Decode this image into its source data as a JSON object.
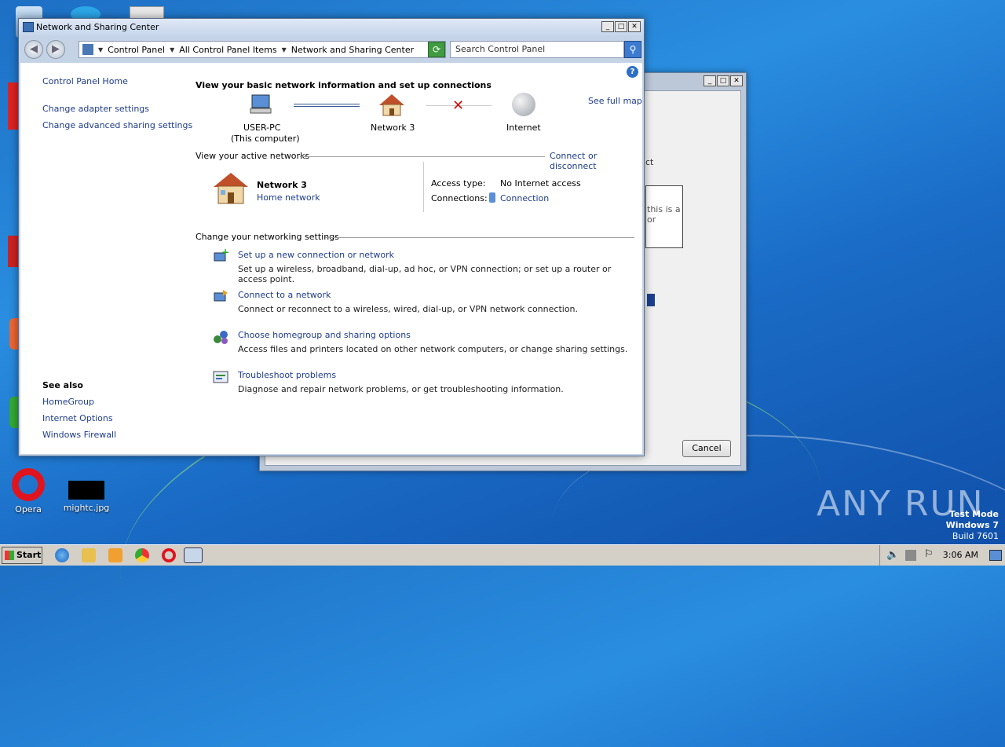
{
  "desktop": {
    "icons": [
      {
        "label": "Opera"
      },
      {
        "label": "mightc.jpg"
      }
    ],
    "watermark": {
      "line1": "Test Mode",
      "line2": "Windows 7",
      "line3": "Build 7601"
    },
    "brand": "ANY RUN"
  },
  "back_window": {
    "cancel_label": "Cancel",
    "frag1": "ct",
    "frag2": "this is a",
    "frag3": "or"
  },
  "window": {
    "title": "Network and Sharing Center",
    "address": {
      "crumbs": [
        "Control Panel",
        "All Control Panel Items",
        "Network and Sharing Center"
      ]
    },
    "search": {
      "placeholder": "Search Control Panel"
    },
    "sidebar": {
      "home": "Control Panel Home",
      "links": [
        "Change adapter settings",
        "Change advanced sharing settings"
      ],
      "see_also_title": "See also",
      "see_also": [
        "HomeGroup",
        "Internet Options",
        "Windows Firewall"
      ]
    },
    "main": {
      "heading": "View your basic network information and set up connections",
      "see_full_map": "See full map",
      "map": {
        "computer_name": "USER-PC",
        "computer_sub": "(This computer)",
        "network_name": "Network  3",
        "internet": "Internet"
      },
      "active_networks_title": "View your active networks",
      "connect_disconnect": "Connect or disconnect",
      "active_network": {
        "name": "Network  3",
        "type": "Home network",
        "access_type_label": "Access type:",
        "access_type_value": "No Internet access",
        "connections_label": "Connections:",
        "connections_value": "Connection"
      },
      "change_settings_title": "Change your networking settings",
      "tasks": [
        {
          "title": "Set up a new connection or network",
          "desc": "Set up a wireless, broadband, dial-up, ad hoc, or VPN connection; or set up a router or access point."
        },
        {
          "title": "Connect to a network",
          "desc": "Connect or reconnect to a wireless, wired, dial-up, or VPN network connection."
        },
        {
          "title": "Choose homegroup and sharing options",
          "desc": "Access files and printers located on other network computers, or change sharing settings."
        },
        {
          "title": "Troubleshoot problems",
          "desc": "Diagnose and repair network problems, or get troubleshooting information."
        }
      ]
    }
  },
  "taskbar": {
    "start_label": "Start",
    "clock": "3:06 AM"
  }
}
